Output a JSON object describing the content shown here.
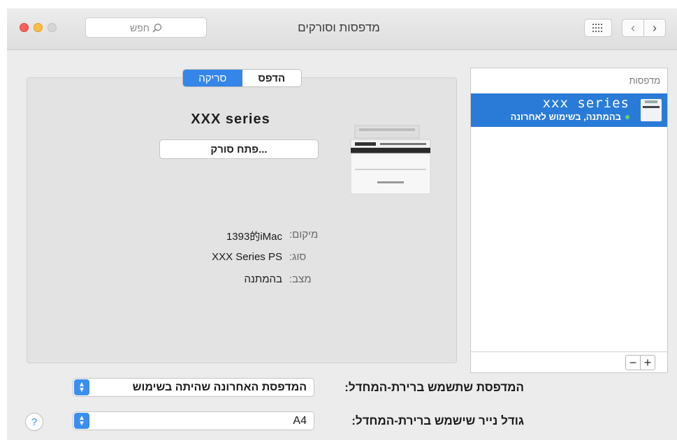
{
  "window": {
    "title": "מדפסות וסורקים",
    "search_placeholder": "חפש"
  },
  "printers_list": {
    "header": "מדפסות",
    "items": [
      {
        "name": "xxx series",
        "status": "בהמתנה, בשימוש לאחרונה"
      }
    ],
    "add_label": "+",
    "remove_label": "−"
  },
  "detail": {
    "tabs": [
      "הדפס",
      "סריקה"
    ],
    "selected_tab": "סריקה",
    "printer_name": "XXX series",
    "open_scanner_label": "פתח סורק...",
    "info": {
      "location_key": "מיקום:",
      "location_value": "1393的iMac",
      "type_key": "סוג:",
      "type_value": "XXX Series PS",
      "status_key": "מצב:",
      "status_value": "בהמתנה"
    }
  },
  "bottom": {
    "default_printer_label": "המדפסת שתשמש ברירת-המחדל:",
    "default_printer_value": "המדפסת האחרונה שהיתה בשימוש",
    "paper_size_label": "גודל נייר שישמש ברירת-המחדל:",
    "paper_size_value": "A4",
    "help_label": "?"
  },
  "colors": {
    "accent": "#3586e8",
    "selection": "#2a7bd8",
    "status_dot": "#5fd66a"
  }
}
